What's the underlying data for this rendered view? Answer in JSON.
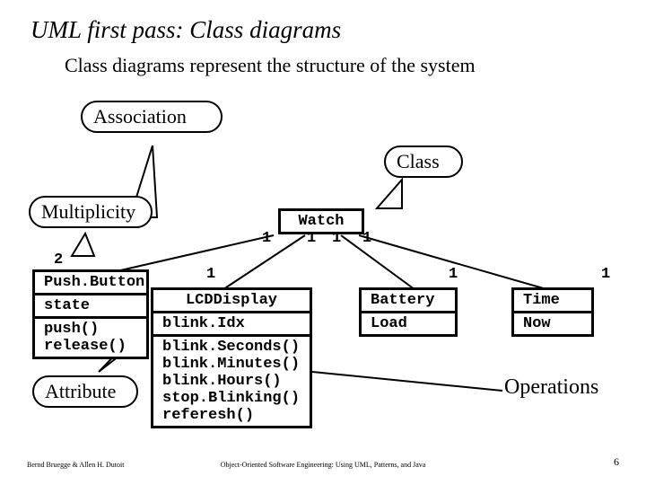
{
  "title": "UML first pass: Class diagrams",
  "subtitle": "Class diagrams represent the structure of the system",
  "callouts": {
    "association": "Association",
    "class": "Class",
    "multiplicity": "Multiplicity",
    "attribute": "Attribute",
    "operations": "Operations"
  },
  "mult": {
    "watch_left": "1",
    "watch_mid_l": "1",
    "watch_mid_r": "1",
    "watch_right": "1",
    "pushbutton": "2",
    "lcd": "1",
    "battery": "1",
    "time": "1"
  },
  "classes": {
    "watch": {
      "name": "Watch"
    },
    "pushbutton": {
      "name": "Push.Button",
      "attrs": [
        "state"
      ],
      "ops": [
        "push()",
        "release()"
      ]
    },
    "lcd": {
      "name": "LCDDisplay",
      "attrs": [
        "blink.Idx"
      ],
      "ops": [
        "blink.Seconds()",
        "blink.Minutes()",
        "blink.Hours()",
        "stop.Blinking()",
        "referesh()"
      ]
    },
    "battery": {
      "name": "Battery",
      "ops": [
        "Load"
      ]
    },
    "time": {
      "name": "Time",
      "ops": [
        "Now"
      ]
    }
  },
  "footer": {
    "left": "Bernd Bruegge & Allen H. Dutoit",
    "center": "Object-Oriented Software Engineering: Using UML, Patterns, and Java",
    "page": "6"
  }
}
